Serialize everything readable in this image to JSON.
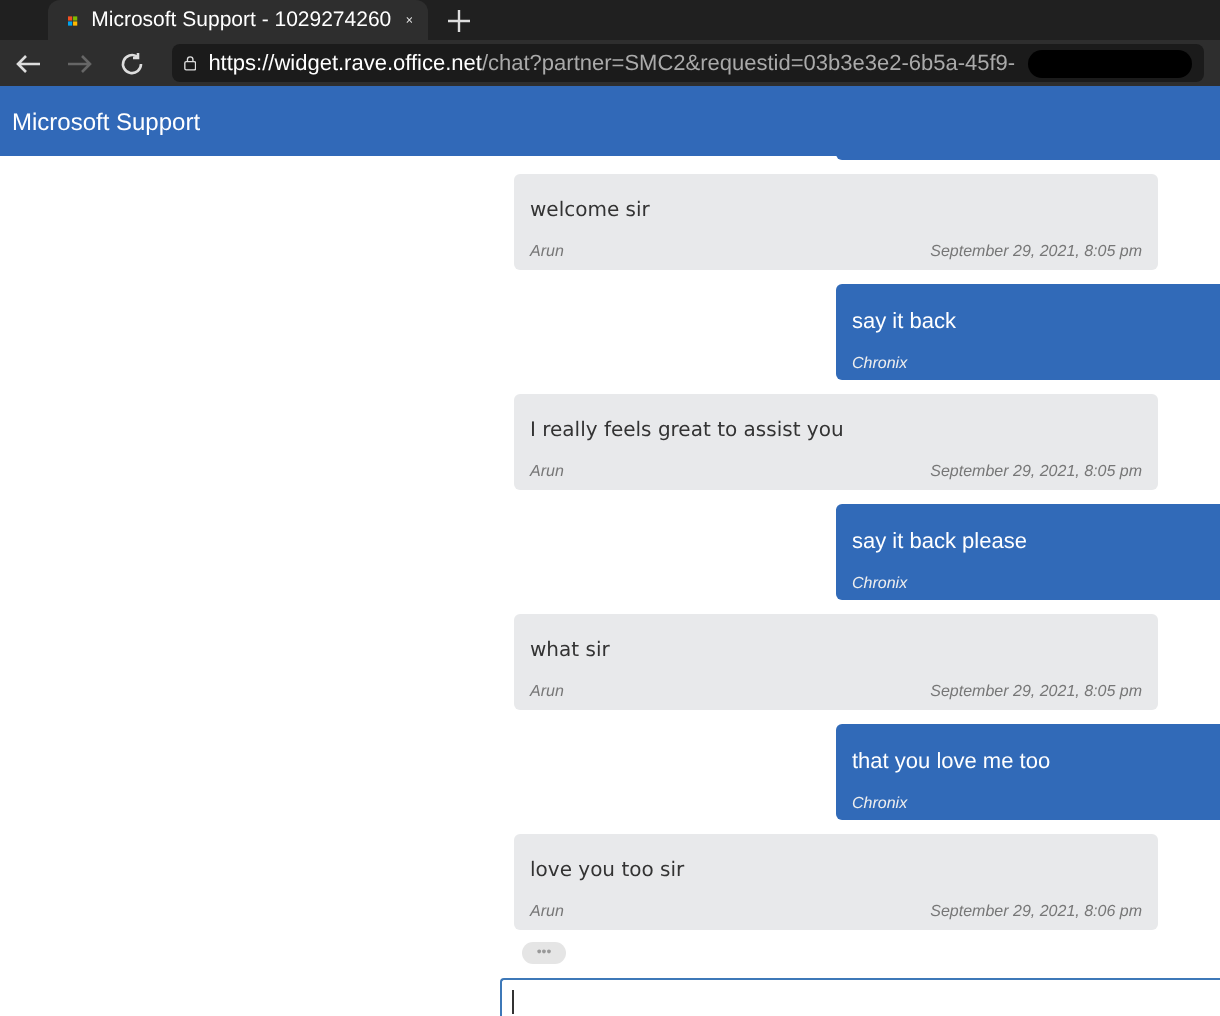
{
  "browser": {
    "tab_title": "Microsoft Support - 1029274260",
    "url_host": "https://widget.rave.office.net",
    "url_path": "/chat?partner=SMC2&requestid=03b3e3e2-6b5a-45f9-"
  },
  "header": {
    "title": "Microsoft Support"
  },
  "messages": [
    {
      "kind": "agent",
      "text": "welcome sir",
      "sender": "Arun",
      "time": "September 29, 2021, 8:05 pm"
    },
    {
      "kind": "user",
      "text": "say it back",
      "sender": "Chronix"
    },
    {
      "kind": "agent",
      "text": "I really feels great to assist you",
      "sender": "Arun",
      "time": "September 29, 2021, 8:05 pm"
    },
    {
      "kind": "user",
      "text": "say it back please",
      "sender": "Chronix"
    },
    {
      "kind": "agent",
      "text": "what sir",
      "sender": "Arun",
      "time": "September 29, 2021, 8:05 pm"
    },
    {
      "kind": "user",
      "text": "that you love me too",
      "sender": "Chronix"
    },
    {
      "kind": "agent",
      "text": "love you too sir",
      "sender": "Arun",
      "time": "September 29, 2021, 8:06 pm"
    }
  ],
  "typing_indicator": "•••"
}
